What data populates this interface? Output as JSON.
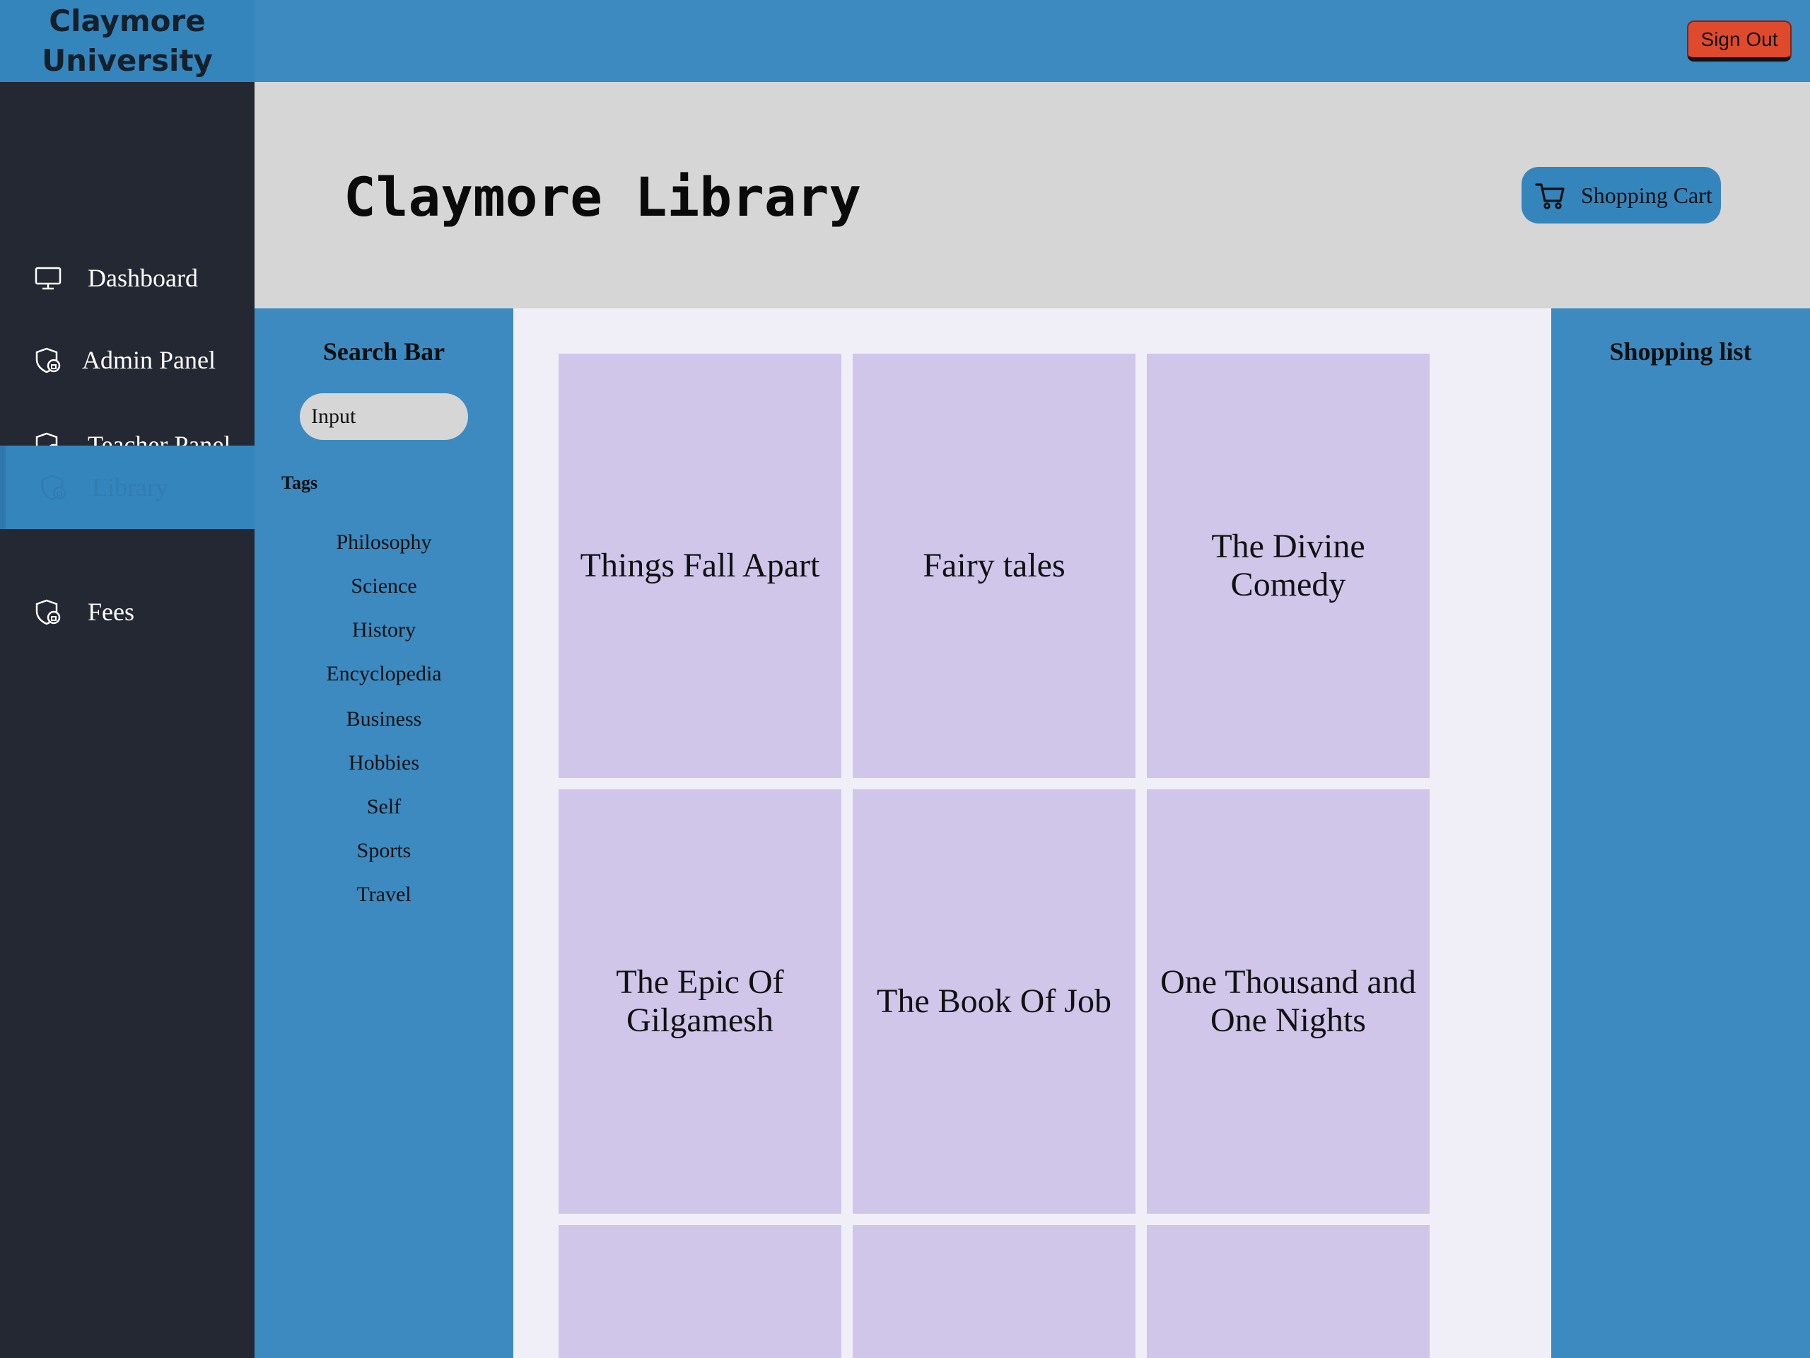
{
  "brand": {
    "line1": "Claymore",
    "line2": "University"
  },
  "topbar": {
    "signout_label": "Sign Out"
  },
  "nav": {
    "items": [
      {
        "label": "Dashboard",
        "icon": "monitor-icon"
      },
      {
        "label": "Admin Panel",
        "icon": "shield-lock-icon"
      },
      {
        "label": "Teacher Panel",
        "icon": "shield-lock-icon"
      },
      {
        "label": "Library",
        "icon": "shield-lock-icon",
        "active": true
      },
      {
        "label": "Fees",
        "icon": "shield-lock-icon"
      }
    ]
  },
  "header": {
    "title": "Claymore Library",
    "cart_label": "Shopping Cart",
    "cart_icon": "shopping-cart-icon"
  },
  "search": {
    "heading": "Search Bar",
    "input_value": "Input",
    "tags_heading": "Tags",
    "tags": [
      "Philosophy",
      "Science",
      "History",
      "Encyclopedia",
      "Business",
      "Hobbies",
      "Self",
      "Sports",
      "Travel"
    ]
  },
  "books": [
    "Things Fall Apart",
    "Fairy tales",
    "The Divine Comedy",
    "The Epic Of Gilgamesh",
    "The Book Of Job",
    "One Thousand and One Nights",
    "",
    "",
    ""
  ],
  "shopping_list": {
    "heading": "Shopping list"
  },
  "colors": {
    "topbar": "#3c8abf",
    "sidenav": "#232832",
    "header_band": "#d6d6d6",
    "book_card": "#cfc6ea",
    "content_bg": "#f0eff8",
    "signout": "#e04a2c"
  }
}
